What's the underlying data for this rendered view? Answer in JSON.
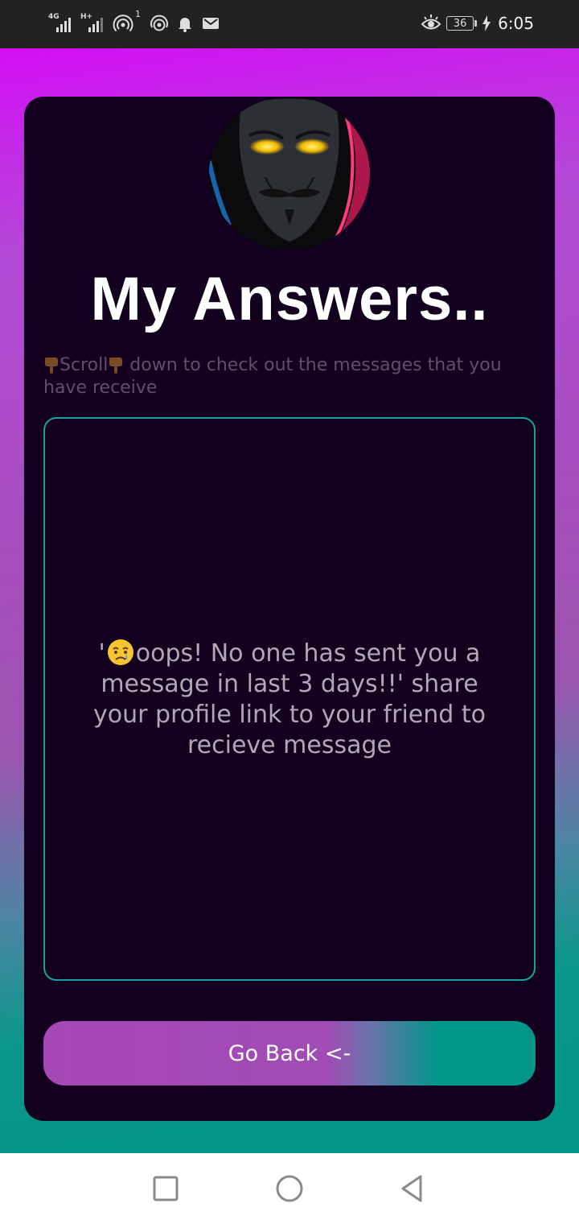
{
  "status_bar": {
    "signal1_label": "4G",
    "signal2_label": "H+",
    "notification_count": "1",
    "battery": "36",
    "time": "6:05",
    "icons": [
      "signal-icon",
      "signal-icon",
      "hotspot-icon",
      "wifi-icon",
      "bell-icon",
      "mail-icon",
      "eye-icon",
      "battery-icon",
      "charging-icon"
    ]
  },
  "main": {
    "title": "My Answers..",
    "subtitle_scroll": "Scroll",
    "subtitle_rest": " down to check out the messages that you have receive",
    "message_box": {
      "prefix": "'",
      "text": "oops! No one has sent you a message in last 3 days!!' share your profile link to your friend to recieve message"
    },
    "go_back_label": "Go Back  <-"
  },
  "nav_bar": {
    "icons": [
      "recent-apps-icon",
      "home-icon",
      "back-icon"
    ]
  },
  "colors": {
    "card_bg": "#13001e",
    "accent_teal": "#009688",
    "accent_purple": "#a647b6",
    "gradient_top": "#d30ef5",
    "message_border": "#14a39a",
    "status_bar_bg": "#222222"
  }
}
